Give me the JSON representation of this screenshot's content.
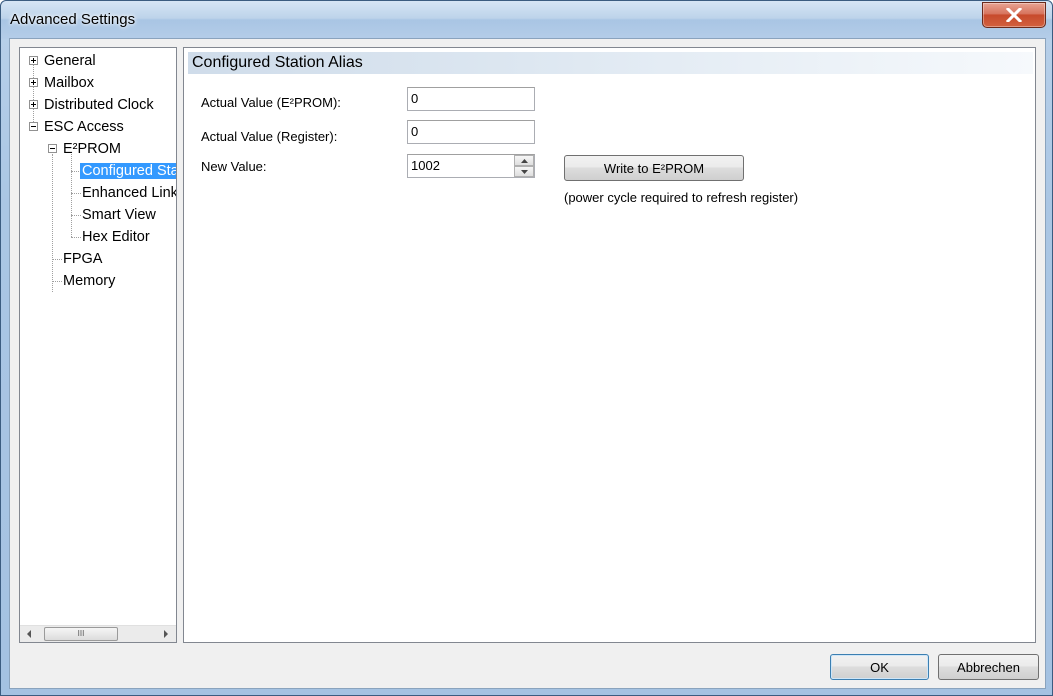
{
  "window": {
    "title": "Advanced Settings",
    "close_icon": "close-icon"
  },
  "tree": {
    "items": [
      {
        "label": "General",
        "expander": "plus",
        "level": 0
      },
      {
        "label": "Mailbox",
        "expander": "plus",
        "level": 0
      },
      {
        "label": "Distributed Clock",
        "expander": "plus",
        "level": 0
      },
      {
        "label": "ESC Access",
        "expander": "minus",
        "level": 0
      },
      {
        "label": "E²PROM",
        "expander": "minus",
        "level": 1
      },
      {
        "label": "Configured Station Alias",
        "expander": null,
        "level": 2,
        "selected": true
      },
      {
        "label": "Enhanced Link Detection",
        "expander": null,
        "level": 2
      },
      {
        "label": "Smart View",
        "expander": null,
        "level": 2
      },
      {
        "label": "Hex Editor",
        "expander": null,
        "level": 2
      },
      {
        "label": "FPGA",
        "expander": null,
        "level": 1
      },
      {
        "label": "Memory",
        "expander": null,
        "level": 1
      }
    ],
    "scroll_thumb_grip": "III"
  },
  "panel": {
    "title": "Configured Station Alias",
    "fields": {
      "eeprom_label": "Actual Value (E²PROM):",
      "eeprom_value": "0",
      "register_label": "Actual Value (Register):",
      "register_value": "0",
      "new_label": "New Value:",
      "new_value": "1002"
    },
    "write_button": "Write to E²PROM",
    "note": "(power cycle required to refresh register)"
  },
  "footer": {
    "ok": "OK",
    "cancel": "Abbrechen"
  },
  "colors": {
    "selection": "#3399ff",
    "close_button": "#c74a2c"
  }
}
